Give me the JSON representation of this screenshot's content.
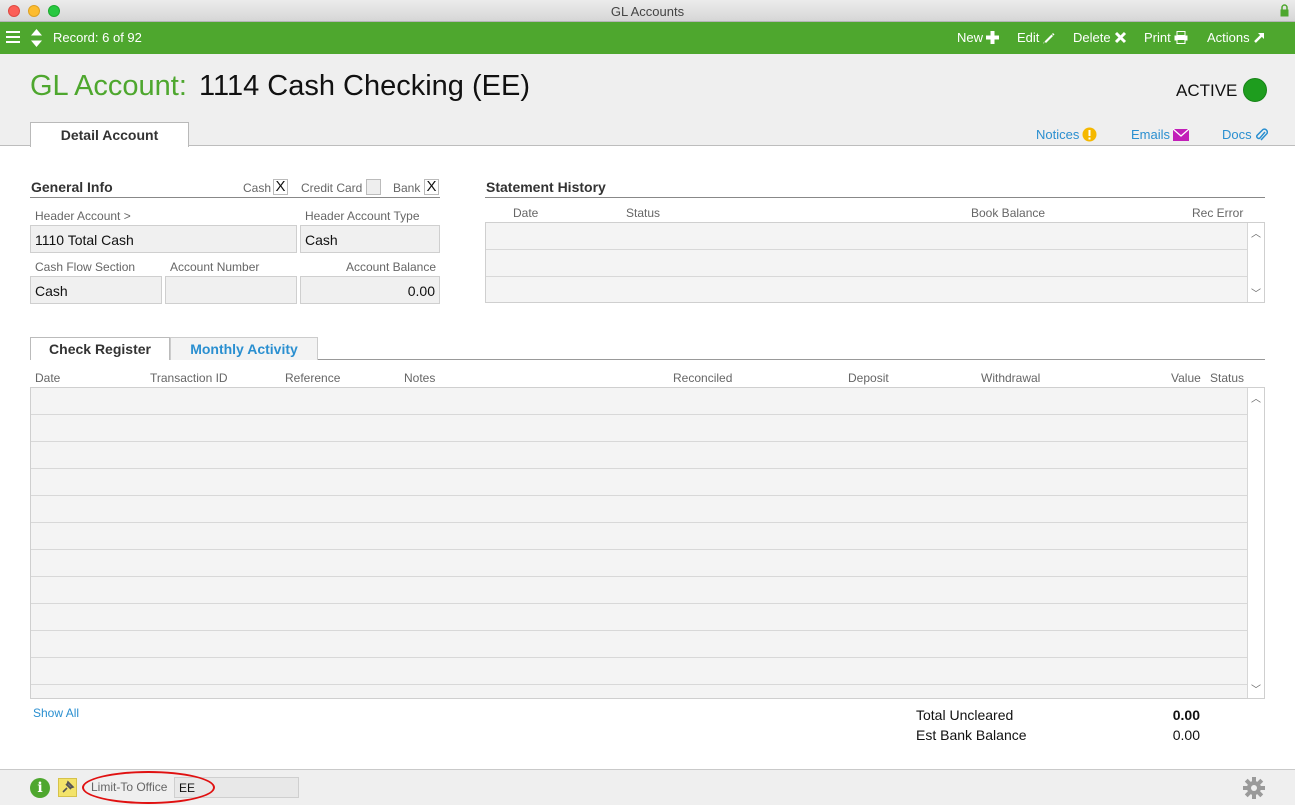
{
  "window": {
    "title": "GL Accounts"
  },
  "toolbar": {
    "record_label": "Record: 6 of 92",
    "new_label": "New",
    "edit_label": "Edit",
    "delete_label": "Delete",
    "print_label": "Print",
    "actions_label": "Actions"
  },
  "header": {
    "label": "GL Account:",
    "account_name": "1114 Cash Checking (EE)",
    "status": "ACTIVE",
    "status_color": "#1e9d1e",
    "tab": "Detail Account",
    "links": {
      "notices": "Notices",
      "emails": "Emails",
      "docs": "Docs"
    }
  },
  "general_info": {
    "title": "General Info",
    "checkboxes": [
      {
        "label": "Cash",
        "checked": true,
        "mark": "X"
      },
      {
        "label": "Credit Card",
        "checked": false,
        "mark": ""
      },
      {
        "label": "Bank",
        "checked": true,
        "mark": "X"
      }
    ],
    "header_account_label": "Header Account >",
    "header_account_value": "1110 Total Cash",
    "header_account_type_label": "Header Account Type",
    "header_account_type_value": "Cash",
    "cash_flow_section_label": "Cash Flow Section",
    "cash_flow_section_value": "Cash",
    "account_number_label": "Account Number",
    "account_number_value": "",
    "account_balance_label": "Account Balance",
    "account_balance_value": "0.00"
  },
  "statement_history": {
    "title": "Statement History",
    "columns": [
      "Date",
      "Status",
      "Book Balance",
      "Rec Error"
    ]
  },
  "tabs": {
    "check_register": "Check Register",
    "monthly_activity": "Monthly Activity"
  },
  "check_register": {
    "columns": [
      "Date",
      "Transaction ID",
      "Reference",
      "Notes",
      "Reconciled",
      "Deposit",
      "Withdrawal",
      "Value",
      "Status"
    ]
  },
  "show_all": "Show All",
  "totals": {
    "uncleared_label": "Total Uncleared",
    "uncleared_value": "0.00",
    "est_bank_label": "Est Bank Balance",
    "est_bank_value": "0.00"
  },
  "footer": {
    "limit_label": "Limit-To Office",
    "limit_value": "EE"
  },
  "colors": {
    "brand_green": "#4ea72e",
    "link_blue": "#2a8fd0",
    "annotation_red": "#e01010"
  },
  "icons": [
    "menu-icon",
    "record-nav-icon",
    "plus-icon",
    "pencil-icon",
    "x-icon",
    "printer-icon",
    "external-arrow-icon",
    "exclamation-icon",
    "envelope-icon",
    "paperclip-icon",
    "info-icon",
    "pin-icon",
    "gear-icon",
    "lock-icon"
  ]
}
